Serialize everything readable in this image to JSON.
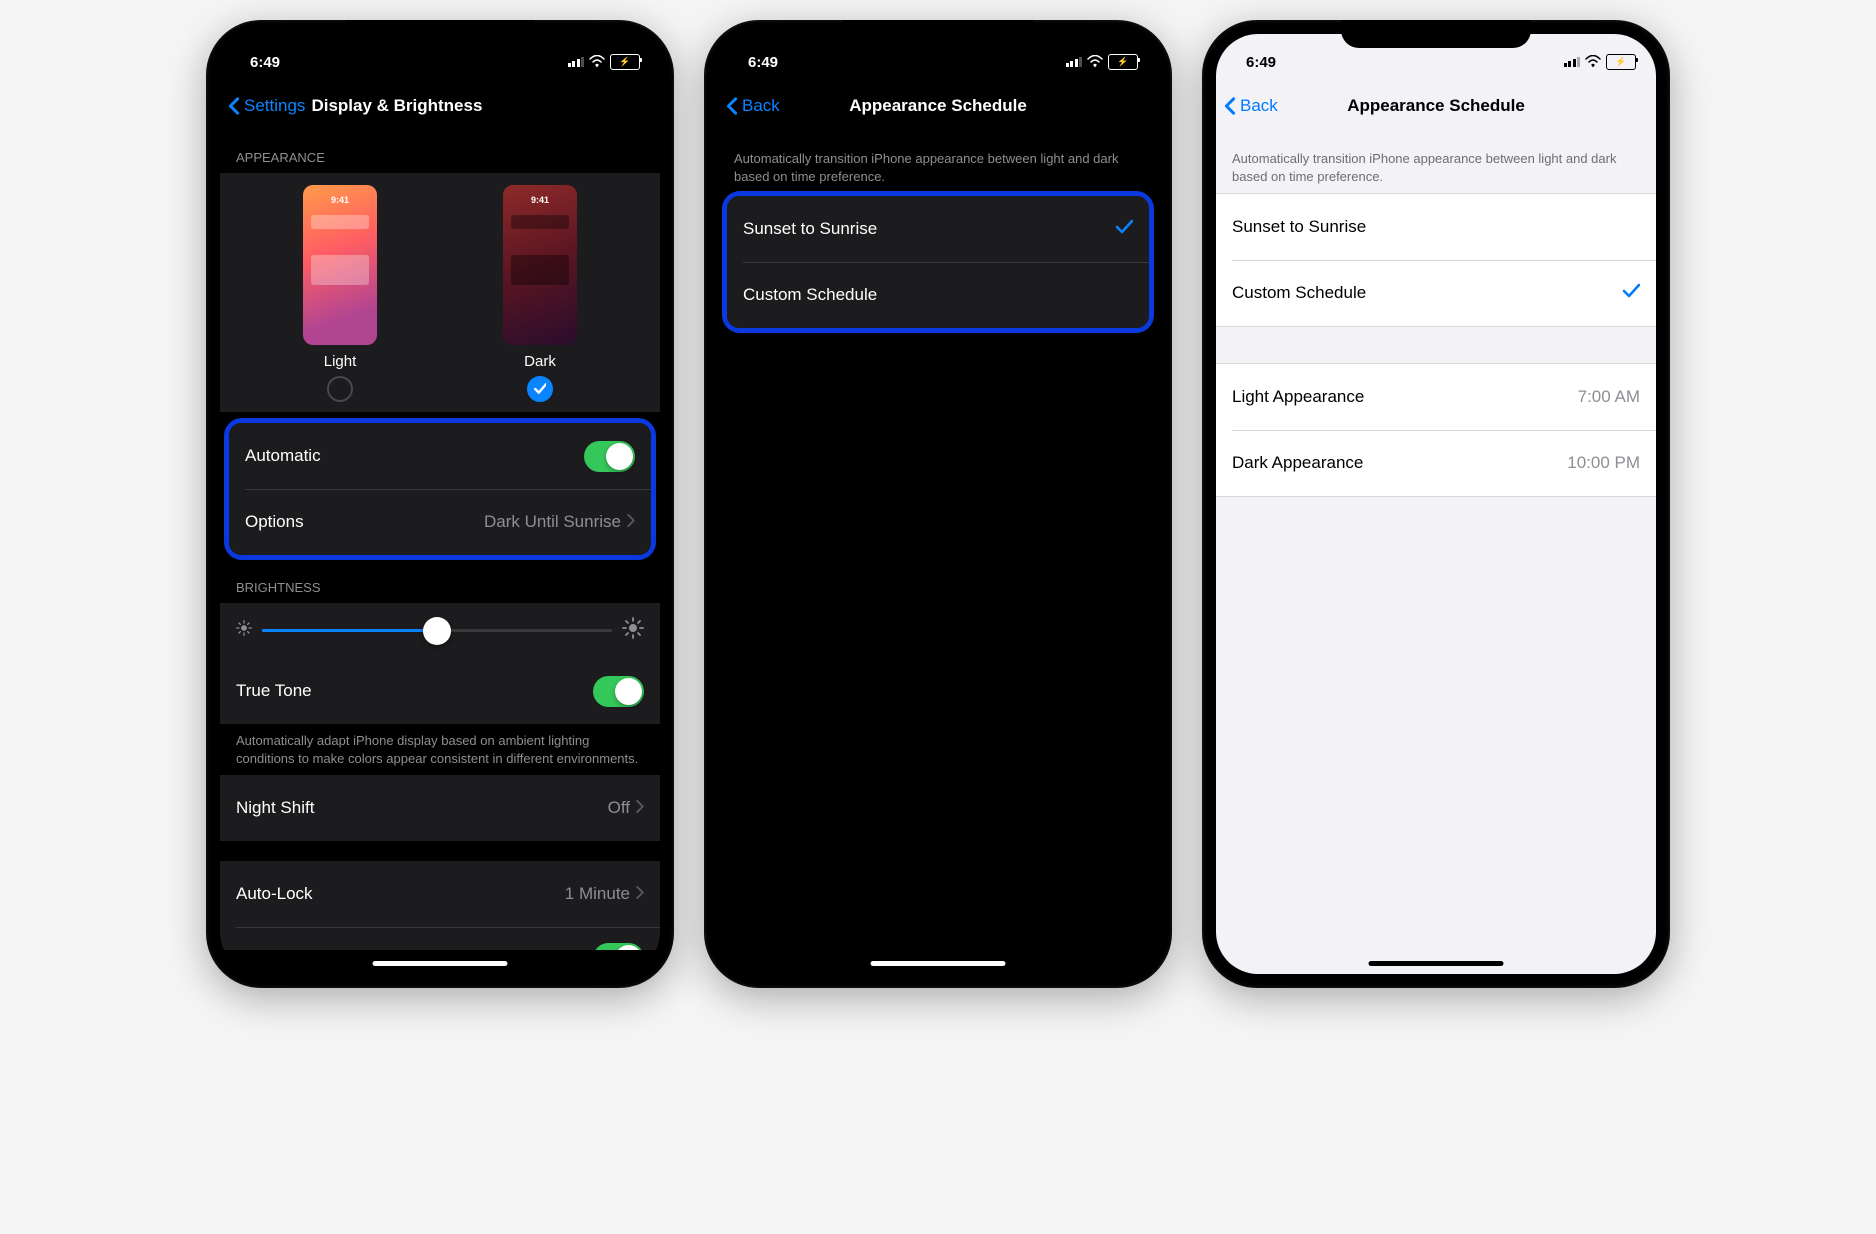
{
  "status": {
    "time": "6:49"
  },
  "phone1": {
    "back_label": "Settings",
    "title": "Display & Brightness",
    "appearance_header": "APPEARANCE",
    "light_label": "Light",
    "dark_label": "Dark",
    "preview_time": "9:41",
    "automatic_label": "Automatic",
    "options_label": "Options",
    "options_value": "Dark Until Sunrise",
    "brightness_header": "BRIGHTNESS",
    "truetone_label": "True Tone",
    "truetone_footer": "Automatically adapt iPhone display based on ambient lighting conditions to make colors appear consistent in different environments.",
    "nightshift_label": "Night Shift",
    "nightshift_value": "Off",
    "autolock_label": "Auto-Lock",
    "autolock_value": "1 Minute"
  },
  "phone2": {
    "back_label": "Back",
    "title": "Appearance Schedule",
    "intro": "Automatically transition iPhone appearance between light and dark based on time preference.",
    "opt_sunset": "Sunset to Sunrise",
    "opt_custom": "Custom Schedule"
  },
  "phone3": {
    "back_label": "Back",
    "title": "Appearance Schedule",
    "intro": "Automatically transition iPhone appearance between light and dark based on time preference.",
    "opt_sunset": "Sunset to Sunrise",
    "opt_custom": "Custom Schedule",
    "light_appearance_label": "Light Appearance",
    "light_time": "7:00 AM",
    "dark_appearance_label": "Dark Appearance",
    "dark_time": "10:00 PM"
  }
}
